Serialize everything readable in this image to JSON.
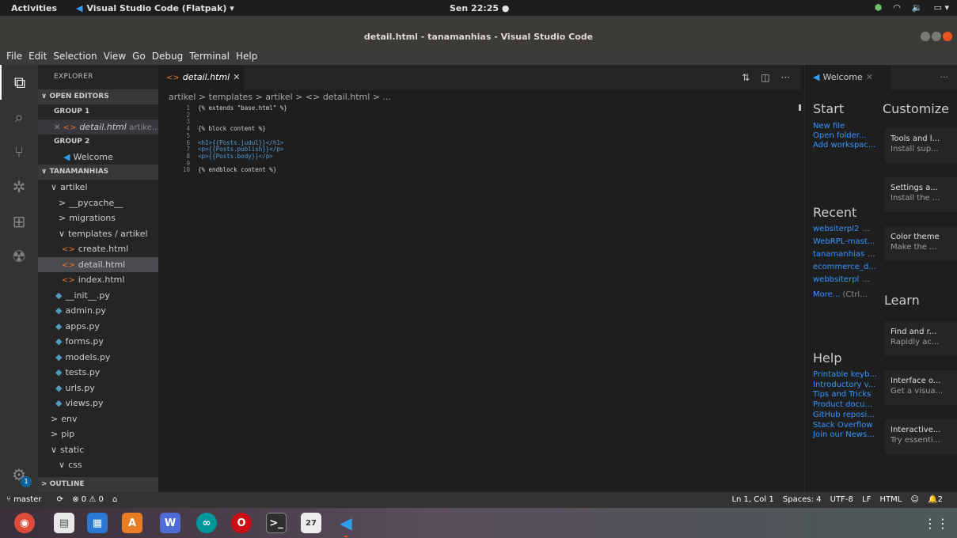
{
  "topbar": {
    "activities": "Activities",
    "app_menu": "Visual Studio Code (Flatpak) ▾",
    "clock": "Sen 22:25 ●"
  },
  "window": {
    "title": "detail.html - tanamanhias - Visual Studio Code"
  },
  "menubar": [
    "File",
    "Edit",
    "Selection",
    "View",
    "Go",
    "Debug",
    "Terminal",
    "Help"
  ],
  "sidebar": {
    "title": "EXPLORER",
    "open_editors": "OPEN EDITORS",
    "group1": "GROUP 1",
    "group1_file": "detail.html",
    "group1_path": "artike...",
    "group2": "GROUP 2",
    "group2_file": "Welcome",
    "project": "TANAMANHIAS",
    "tree": [
      {
        "label": "artikel",
        "prefix": "∨",
        "indent": 16,
        "type": "folder"
      },
      {
        "label": "__pycache__",
        "prefix": ">",
        "indent": 26,
        "type": "folder"
      },
      {
        "label": "migrations",
        "prefix": ">",
        "indent": 26,
        "type": "folder"
      },
      {
        "label": "templates / artikel",
        "prefix": "∨",
        "indent": 26,
        "type": "folder"
      },
      {
        "label": "create.html",
        "prefix": "<>",
        "indent": 30,
        "type": "html"
      },
      {
        "label": "detail.html",
        "prefix": "<>",
        "indent": 30,
        "type": "html",
        "selected": true
      },
      {
        "label": "index.html",
        "prefix": "<>",
        "indent": 30,
        "type": "html"
      },
      {
        "label": "__init__.py",
        "prefix": "◆",
        "indent": 22,
        "type": "py"
      },
      {
        "label": "admin.py",
        "prefix": "◆",
        "indent": 22,
        "type": "py"
      },
      {
        "label": "apps.py",
        "prefix": "◆",
        "indent": 22,
        "type": "py"
      },
      {
        "label": "forms.py",
        "prefix": "◆",
        "indent": 22,
        "type": "py"
      },
      {
        "label": "models.py",
        "prefix": "◆",
        "indent": 22,
        "type": "py"
      },
      {
        "label": "tests.py",
        "prefix": "◆",
        "indent": 22,
        "type": "py"
      },
      {
        "label": "urls.py",
        "prefix": "◆",
        "indent": 22,
        "type": "py"
      },
      {
        "label": "views.py",
        "prefix": "◆",
        "indent": 22,
        "type": "py"
      },
      {
        "label": "env",
        "prefix": ">",
        "indent": 16,
        "type": "folder"
      },
      {
        "label": "pip",
        "prefix": ">",
        "indent": 16,
        "type": "folder"
      },
      {
        "label": "static",
        "prefix": "∨",
        "indent": 16,
        "type": "folder"
      },
      {
        "label": "css",
        "prefix": "∨",
        "indent": 26,
        "type": "folder"
      }
    ],
    "outline": "OUTLINE"
  },
  "editor": {
    "tab": "detail.html",
    "breadcrumb": "artikel > templates > artikel > <> detail.html > ...",
    "lines": [
      {
        "n": "1",
        "text": "{% extends \"base.html\" %}",
        "kind": "tpl"
      },
      {
        "n": "2",
        "text": "",
        "kind": "tpl"
      },
      {
        "n": "3",
        "text": "",
        "kind": "tpl"
      },
      {
        "n": "4",
        "text": "{% block content %}",
        "kind": "tpl"
      },
      {
        "n": "5",
        "text": "",
        "kind": "tpl"
      },
      {
        "n": "6",
        "text": "<h1>{{Posts.judul}}</h1>",
        "kind": "html"
      },
      {
        "n": "7",
        "text": "<p>{{Posts.publish}}</p>",
        "kind": "html"
      },
      {
        "n": "8",
        "text": "<p>{{Posts.body}}</p>",
        "kind": "html"
      },
      {
        "n": "9",
        "text": "",
        "kind": "tpl"
      },
      {
        "n": "10",
        "text": "{% endblock content %}",
        "kind": "tpl"
      }
    ]
  },
  "welcome": {
    "tab": "Welcome",
    "start": "Start",
    "start_links": [
      "New file",
      "Open folder...",
      "Add workspac..."
    ],
    "recent": "Recent",
    "recent_links": [
      {
        "name": "websiterpl2",
        "path": "..."
      },
      {
        "name": "WebRPL-mast...",
        "path": ""
      },
      {
        "name": "tanamanhias",
        "path": "..."
      },
      {
        "name": "ecommerce_d...",
        "path": ""
      },
      {
        "name": "webbsiterpl",
        "path": "..."
      }
    ],
    "more": "More...",
    "more_hint": "(Ctrl...",
    "help": "Help",
    "help_links": [
      "Printable keyb...",
      "Introductory v...",
      "Tips and Tricks",
      "Product docu...",
      "GitHub reposi...",
      "Stack Overflow",
      "Join our News..."
    ],
    "customize": "Customize",
    "learn": "Learn",
    "customize_cards": [
      {
        "title": "Tools and l...",
        "sub": "Install sup..."
      },
      {
        "title": "Settings a...",
        "sub": "Install the ..."
      },
      {
        "title": "Color theme",
        "sub": "Make the ..."
      }
    ],
    "learn_cards": [
      {
        "title": "Find and r...",
        "sub": "Rapidly ac..."
      },
      {
        "title": "Interface o...",
        "sub": "Get a visua..."
      },
      {
        "title": "Interactive...",
        "sub": "Try essenti..."
      }
    ]
  },
  "statusbar": {
    "branch": "master",
    "sync": "⟳",
    "problems": "⊗ 0 ⚠ 0",
    "home": "⌂",
    "position": "Ln 1, Col 1",
    "spaces": "Spaces: 4",
    "encoding": "UTF-8",
    "eol": "LF",
    "language": "HTML",
    "feedback": "☺",
    "notifications": "🔔2"
  },
  "activity_badge": "1",
  "dock": {
    "calendar_day": "27"
  },
  "colors": {
    "accent": "#007acc",
    "link": "#3794ff",
    "ubuntu_orange": "#e95420"
  }
}
